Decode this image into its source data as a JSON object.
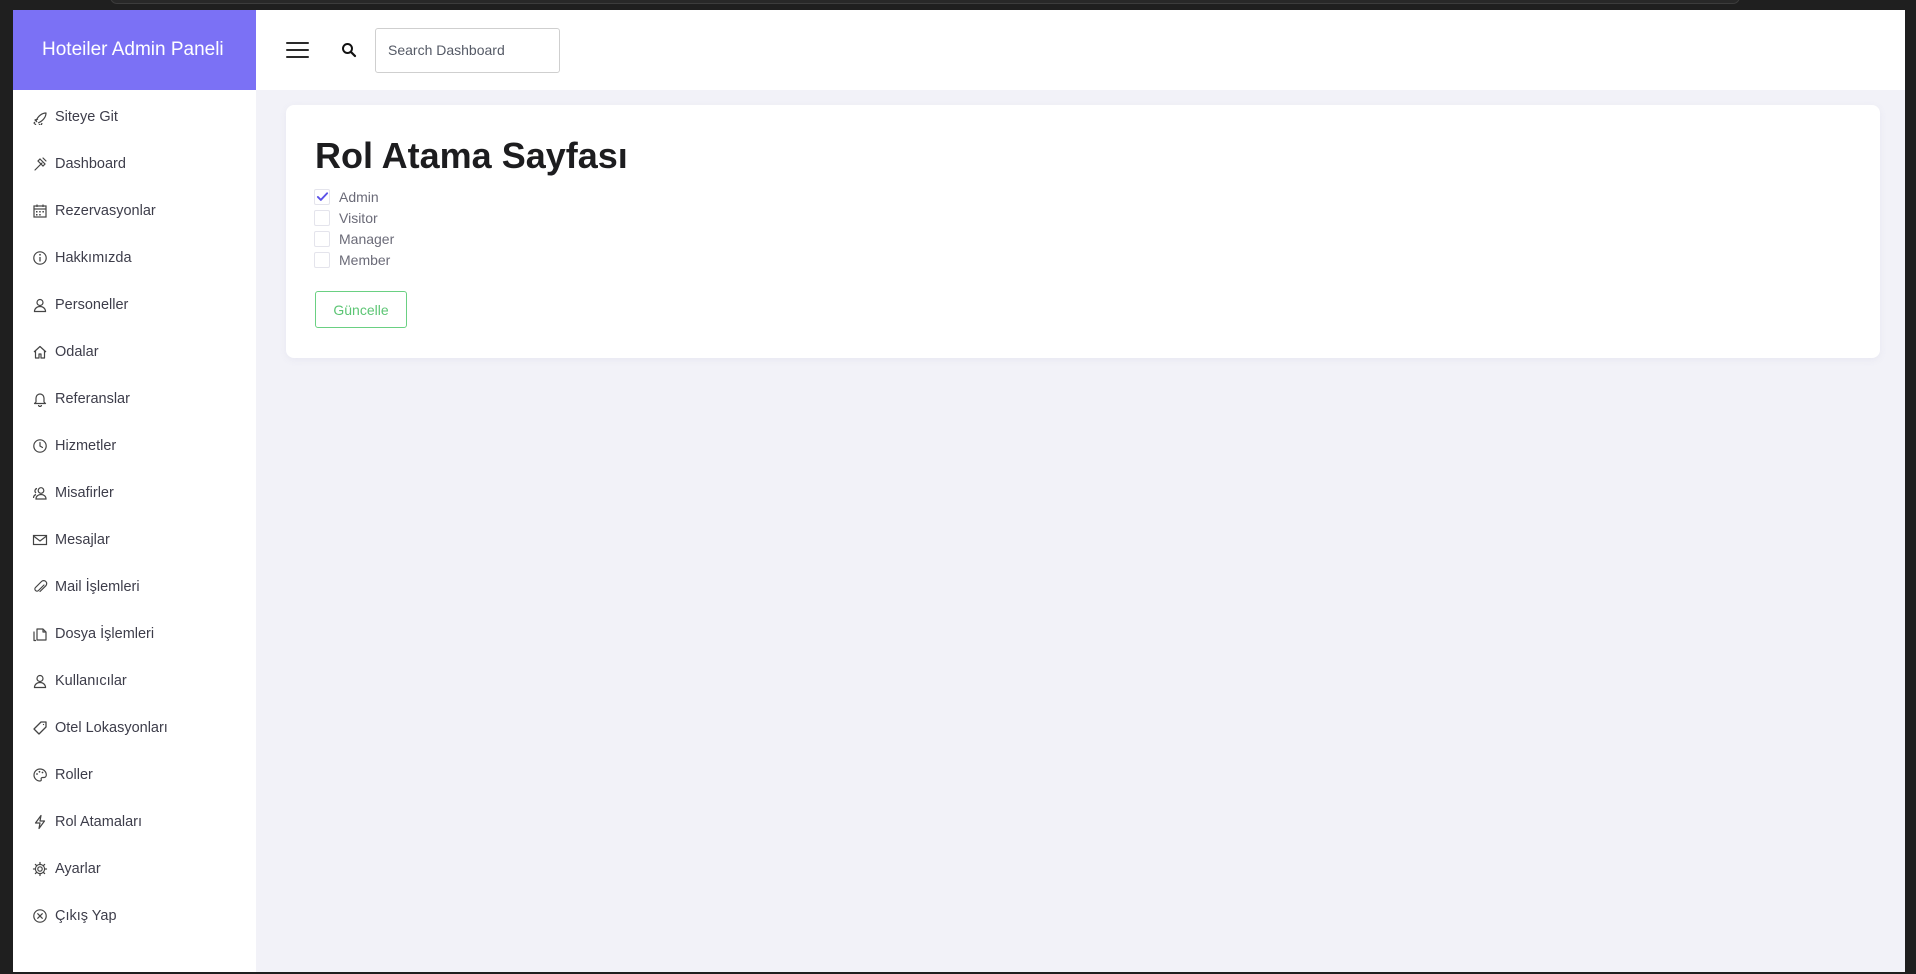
{
  "app": {
    "brand": "Hoteiler Admin Paneli"
  },
  "sidebar": {
    "items": [
      {
        "label": "Siteye Git",
        "icon": "rocket-icon"
      },
      {
        "label": "Dashboard",
        "icon": "hammer-icon"
      },
      {
        "label": "Rezervasyonlar",
        "icon": "calendar-icon"
      },
      {
        "label": "Hakkımızda",
        "icon": "info-icon"
      },
      {
        "label": "Personeller",
        "icon": "user-icon"
      },
      {
        "label": "Odalar",
        "icon": "home-icon"
      },
      {
        "label": "Referanslar",
        "icon": "bell-icon"
      },
      {
        "label": "Hizmetler",
        "icon": "clock-icon"
      },
      {
        "label": "Misafirler",
        "icon": "users-icon"
      },
      {
        "label": "Mesajlar",
        "icon": "envelope-icon"
      },
      {
        "label": "Mail İşlemleri",
        "icon": "paperclip-icon"
      },
      {
        "label": "Dosya İşlemleri",
        "icon": "files-icon"
      },
      {
        "label": "Kullanıcılar",
        "icon": "user-icon"
      },
      {
        "label": "Otel Lokasyonları",
        "icon": "tag-icon"
      },
      {
        "label": "Roller",
        "icon": "palette-icon"
      },
      {
        "label": "Rol Atamaları",
        "icon": "bolt-icon"
      },
      {
        "label": "Ayarlar",
        "icon": "gear-icon"
      },
      {
        "label": "Çıkış Yap",
        "icon": "close-circle-icon"
      }
    ]
  },
  "topbar": {
    "search_placeholder": "Search Dashboard"
  },
  "main": {
    "title": "Rol Atama Sayfası",
    "roles": [
      {
        "label": "Admin",
        "checked": true
      },
      {
        "label": "Visitor",
        "checked": false
      },
      {
        "label": "Manager",
        "checked": false
      },
      {
        "label": "Member",
        "checked": false
      }
    ],
    "update_label": "Güncelle"
  },
  "colors": {
    "brand": "#7b71f5",
    "check": "#5b52e8",
    "update_button": "#5cc574",
    "background": "#f2f2f8"
  }
}
